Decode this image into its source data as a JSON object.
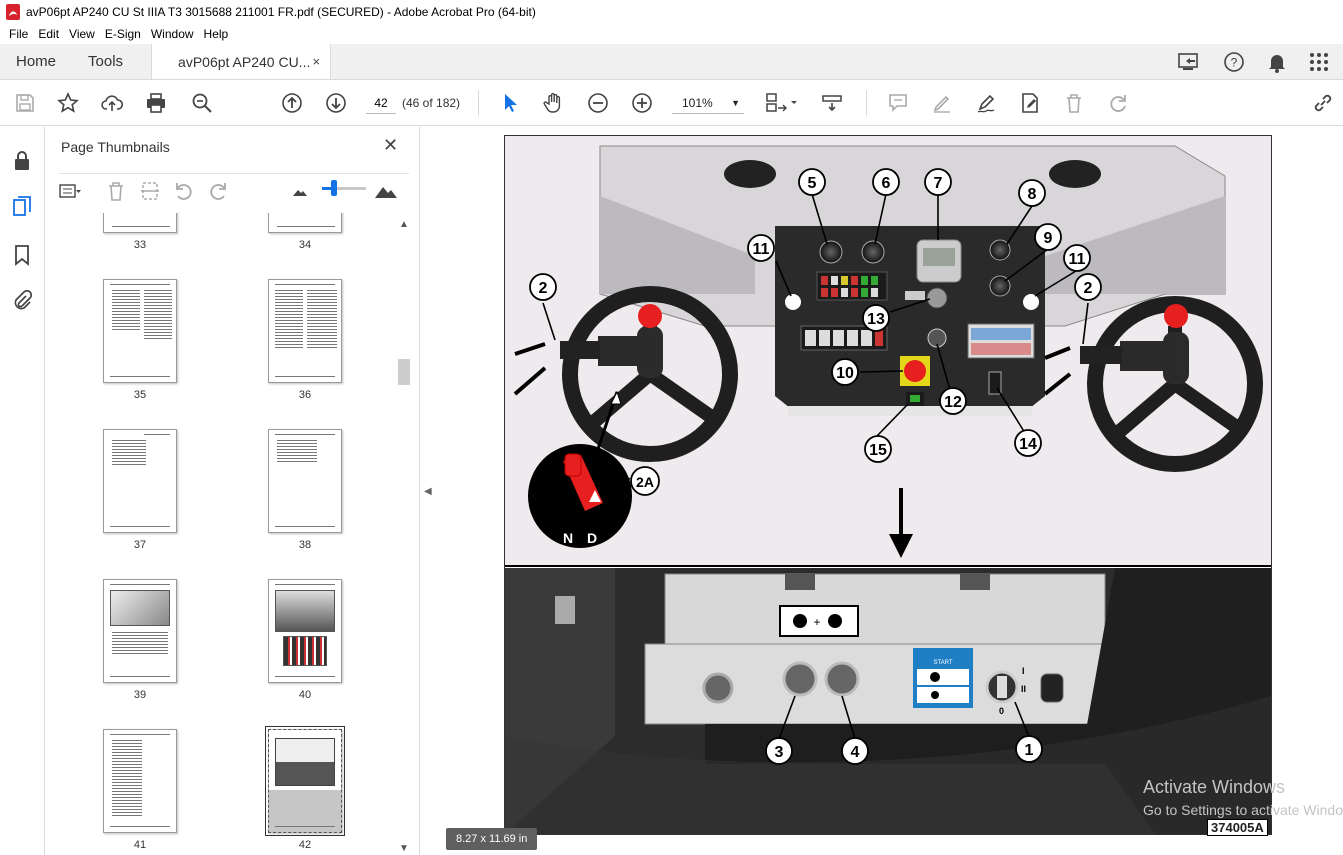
{
  "window": {
    "title": "avP06pt AP240 CU St IIIA T3 3015688 211001 FR.pdf (SECURED) - Adobe Acrobat Pro (64-bit)"
  },
  "menu": [
    "File",
    "Edit",
    "View",
    "E-Sign",
    "Window",
    "Help"
  ],
  "tabs": {
    "home": "Home",
    "tools": "Tools",
    "document": "avP06pt AP240 CU...",
    "close": "×"
  },
  "toolbar": {
    "page_input": "42",
    "page_count": "(46 of 182)",
    "zoom": "101%"
  },
  "panel": {
    "title": "Page Thumbnails",
    "close": "✕",
    "thumbnails": [
      {
        "label": "33"
      },
      {
        "label": "34"
      },
      {
        "label": "35"
      },
      {
        "label": "36"
      },
      {
        "label": "37"
      },
      {
        "label": "38"
      },
      {
        "label": "39"
      },
      {
        "label": "40"
      },
      {
        "label": "41"
      },
      {
        "label": "42"
      }
    ]
  },
  "document": {
    "page_size": "8.27 x 11.69 in",
    "figure_code": "374005A",
    "callouts_top": [
      "5",
      "6",
      "7",
      "8",
      "9",
      "11",
      "11",
      "2",
      "2",
      "13",
      "10",
      "12",
      "14",
      "15",
      "2A"
    ],
    "gear_labels": {
      "n": "N",
      "d": "D"
    },
    "callouts_bottom": [
      "3",
      "4",
      "1"
    ],
    "start_label": "START",
    "switch_positions": {
      "i": "I",
      "ii": "II",
      "zero": "0"
    }
  },
  "watermark": {
    "line1": "Activate Windows",
    "line2": "Go to Settings to activate Windows."
  },
  "colors": {
    "accent": "#1473e6",
    "estop": "#e81f1f",
    "start_panel": "#1e7fc5"
  }
}
